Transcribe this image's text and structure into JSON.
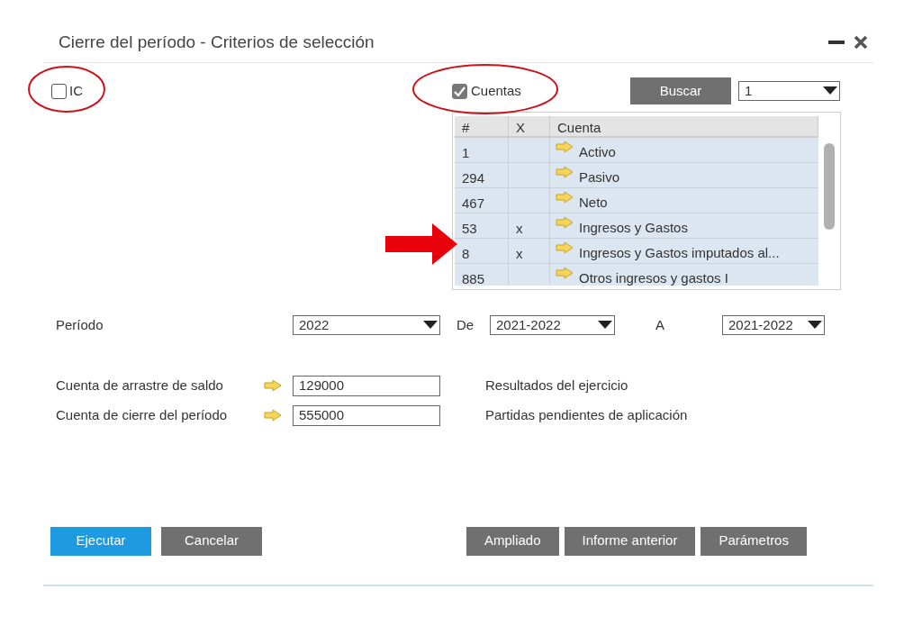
{
  "window": {
    "title": "Cierre del período - Criterios de selección"
  },
  "ic_checkbox": {
    "label": "IC",
    "checked": false
  },
  "cuentas_checkbox": {
    "label": "Cuentas",
    "checked": true
  },
  "search_button": {
    "label": "Buscar"
  },
  "search_select": {
    "value": "1"
  },
  "table": {
    "columns": [
      "#",
      "X",
      "Cuenta"
    ],
    "rows": [
      {
        "num": "1",
        "x": "",
        "cuenta": "Activo"
      },
      {
        "num": "294",
        "x": "",
        "cuenta": "Pasivo"
      },
      {
        "num": "467",
        "x": "",
        "cuenta": "Neto"
      },
      {
        "num": "53",
        "x": "x",
        "cuenta": "Ingresos y Gastos"
      },
      {
        "num": "8",
        "x": "x",
        "cuenta": "Ingresos y Gastos imputados al..."
      },
      {
        "num": "885",
        "x": "",
        "cuenta": "Otros ingresos y gastos I"
      }
    ]
  },
  "periodo": {
    "label": "Período",
    "value": "2022",
    "from_label": "De",
    "from_value": "2021-2022",
    "to_label": "A",
    "to_value": "2021-2022"
  },
  "accounts": [
    {
      "label": "Cuenta de arrastre de saldo",
      "value": "129000",
      "description": "Resultados del ejercicio"
    },
    {
      "label": "Cuenta de cierre del período",
      "value": "555000",
      "description": "Partidas pendientes de aplicación"
    }
  ],
  "buttons_left": [
    {
      "label": "Ejecutar",
      "kind": "primary"
    },
    {
      "label": "Cancelar",
      "kind": "secondary"
    }
  ],
  "buttons_right": [
    {
      "label": "Ampliado"
    },
    {
      "label": "Informe anterior"
    },
    {
      "label": "Parámetros"
    }
  ]
}
